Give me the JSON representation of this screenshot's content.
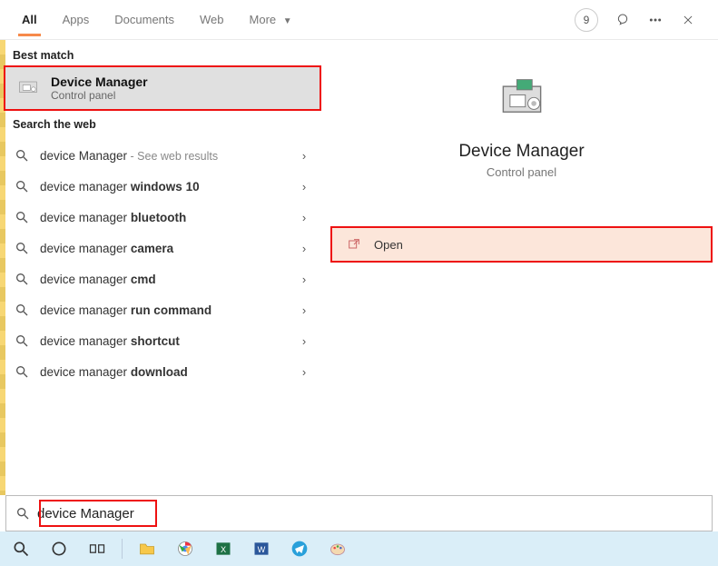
{
  "tabs": {
    "all": "All",
    "apps": "Apps",
    "documents": "Documents",
    "web": "Web",
    "more": "More"
  },
  "header": {
    "badge_count": "9"
  },
  "best_match": {
    "section_label": "Best match",
    "title": "Device Manager",
    "subtitle": "Control panel"
  },
  "web_section_label": "Search the web",
  "web_results": [
    {
      "prefix": "device Manager",
      "bold": "",
      "suffix": " - See web results"
    },
    {
      "prefix": "device manager ",
      "bold": "windows 10",
      "suffix": ""
    },
    {
      "prefix": "device manager ",
      "bold": "bluetooth",
      "suffix": ""
    },
    {
      "prefix": "device manager ",
      "bold": "camera",
      "suffix": ""
    },
    {
      "prefix": "device manager ",
      "bold": "cmd",
      "suffix": ""
    },
    {
      "prefix": "device manager ",
      "bold": "run command",
      "suffix": ""
    },
    {
      "prefix": "device manager ",
      "bold": "shortcut",
      "suffix": ""
    },
    {
      "prefix": "device manager ",
      "bold": "download",
      "suffix": ""
    }
  ],
  "detail": {
    "title": "Device Manager",
    "subtitle": "Control panel",
    "action_open": "Open"
  },
  "search_input": {
    "value": "device Manager"
  }
}
